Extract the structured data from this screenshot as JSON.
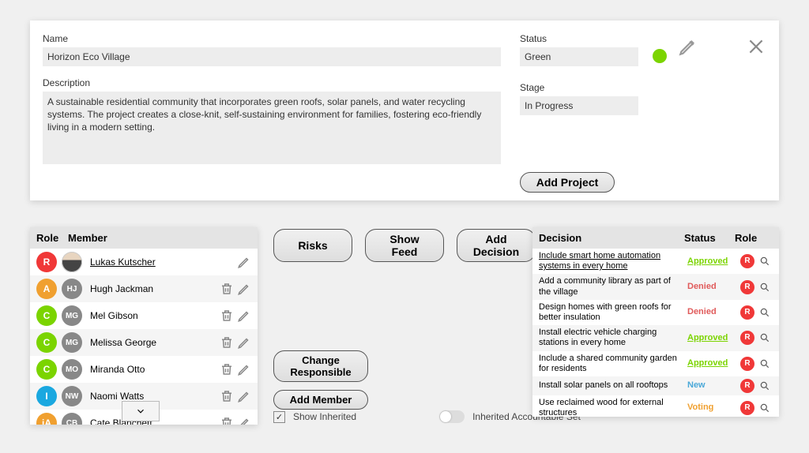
{
  "top": {
    "name_label": "Name",
    "name_value": "Horizon Eco Village",
    "desc_label": "Description",
    "desc_value": "A sustainable residential community that incorporates green roofs, solar panels, and water recycling systems. The project creates a close-knit, self-sustaining environment for families, fostering eco-friendly living in a modern setting.",
    "status_label": "Status",
    "status_value": "Green",
    "status_color": "#7bd400",
    "stage_label": "Stage",
    "stage_value": "In Progress",
    "add_project": "Add Project"
  },
  "members_section": {
    "h_role": "Role",
    "h_member": "Member",
    "rows": [
      {
        "role": "R",
        "role_color": "#f03838",
        "initials": "",
        "name": "Lukas Kutscher",
        "has_avatar_img": true,
        "underline": true,
        "show_trash": false
      },
      {
        "role": "A",
        "role_color": "#f0a030",
        "initials": "HJ",
        "name": "Hugh Jackman",
        "has_avatar_img": false,
        "underline": false,
        "show_trash": true
      },
      {
        "role": "C",
        "role_color": "#7bd400",
        "initials": "MG",
        "name": "Mel Gibson",
        "has_avatar_img": false,
        "underline": false,
        "show_trash": true
      },
      {
        "role": "C",
        "role_color": "#7bd400",
        "initials": "MG",
        "name": "Melissa George",
        "has_avatar_img": false,
        "underline": false,
        "show_trash": true
      },
      {
        "role": "C",
        "role_color": "#7bd400",
        "initials": "MO",
        "name": "Miranda Otto",
        "has_avatar_img": false,
        "underline": false,
        "show_trash": true
      },
      {
        "role": "I",
        "role_color": "#1aa8e0",
        "initials": "NW",
        "name": "Naomi Watts",
        "has_avatar_img": false,
        "underline": false,
        "show_trash": true
      },
      {
        "role": "iA",
        "role_color": "#f0a030",
        "initials": "CB",
        "name": "Cate Blanchett",
        "has_avatar_img": false,
        "underline": false,
        "show_trash": true
      }
    ]
  },
  "middle": {
    "risks": "Risks",
    "show_feed": "Show Feed",
    "add_decision": "Add Decision",
    "change_responsible": "Change Responsible",
    "add_member": "Add Member",
    "show_inherited": "Show Inherited",
    "inherited_acc_set": "Inherited Accountable Set"
  },
  "decisions_section": {
    "h_decision": "Decision",
    "h_status": "Status",
    "h_role": "Role",
    "rows": [
      {
        "name": "Include smart home automation systems in every home",
        "status": "Approved",
        "status_class": "st-approved",
        "underline": true
      },
      {
        "name": "Add a community library as part of the village",
        "status": "Denied",
        "status_class": "st-denied",
        "underline": false
      },
      {
        "name": "Design homes with green roofs for better insulation",
        "status": "Denied",
        "status_class": "st-denied",
        "underline": false
      },
      {
        "name": "Install electric vehicle charging stations in every home",
        "status": "Approved",
        "status_class": "st-approved",
        "underline": false
      },
      {
        "name": "Include a shared community garden for residents",
        "status": "Approved",
        "status_class": "st-approved",
        "underline": false
      },
      {
        "name": "Install solar panels on all rooftops",
        "status": "New",
        "status_class": "st-new",
        "underline": false
      },
      {
        "name": "Use reclaimed wood for external structures",
        "status": "Voting",
        "status_class": "st-voting",
        "underline": false
      }
    ]
  }
}
